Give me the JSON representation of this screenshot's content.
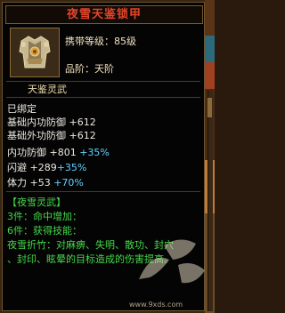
{
  "item": {
    "title": "夜雪天鉴锁甲",
    "level_text": "携带等级：85级",
    "rank_text": "品阶：天阶",
    "set_name": "天鉴灵武"
  },
  "status": {
    "bound": "已绑定"
  },
  "attrs": [
    {
      "label": "基础内功防御",
      "value": "+612",
      "bonus": ""
    },
    {
      "label": "基础外功防御",
      "value": "+612",
      "bonus": ""
    },
    {
      "label": "内功防御",
      "value": "+801",
      "bonus": "+35%"
    },
    {
      "label": "闪避",
      "value": "+289",
      "bonus": "+35%"
    },
    {
      "label": "体力",
      "value": "+53",
      "bonus": "+70%"
    }
  ],
  "set": {
    "header": "【夜雪灵武】",
    "bonus3": "3件：命中增加：",
    "bonus6": "6件：获得技能：",
    "skill_line1": "夜雪折竹：对麻痹、失明、散功、封穴",
    "skill_line2": "、封印、眩晕的目标造成的伤害提高。"
  },
  "watermark": {
    "url": "www.9xds.com"
  },
  "colors": {
    "title": "#e2452c",
    "green": "#44d84a",
    "cyan": "#62d0ff",
    "border": "#6b5530"
  }
}
